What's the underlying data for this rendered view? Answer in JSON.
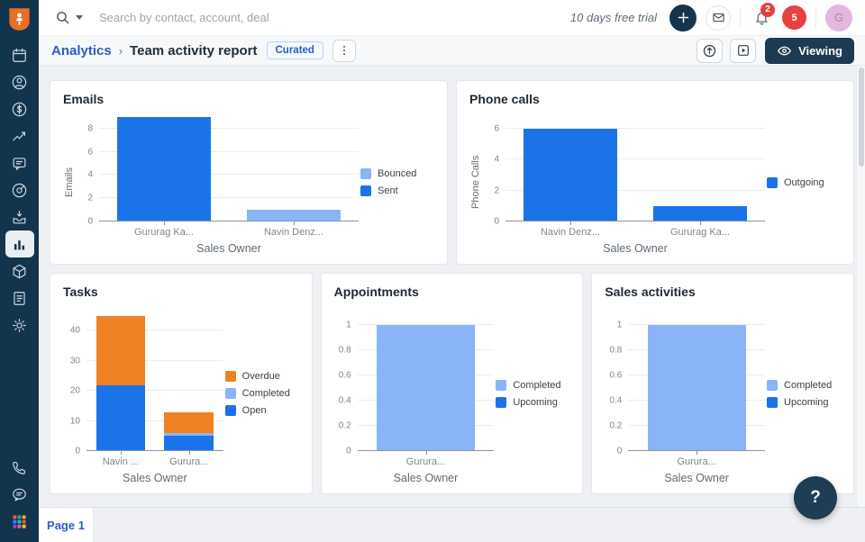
{
  "topbar": {
    "search_placeholder": "Search by contact, account, deal",
    "trial_text": "10 days free trial",
    "bell_badge": "2",
    "notif_count": "5",
    "avatar_initial": "G"
  },
  "breadcrumb": {
    "parent": "Analytics",
    "separator": "›",
    "title": "Team activity report",
    "badge": "Curated",
    "viewing_label": "Viewing"
  },
  "sidebar": {
    "icons": [
      "calendar-icon",
      "contacts-icon",
      "deals-icon",
      "trend-icon",
      "conversations-icon",
      "goals-icon",
      "inbox-icon",
      "analytics-icon",
      "products-icon",
      "invoices-icon",
      "settings-icon",
      "phone-icon",
      "chat-bubble-icon",
      "apps-grid-icon"
    ],
    "active_item": "analytics"
  },
  "footer": {
    "page_tab": "Page 1"
  },
  "help_label": "?",
  "colors": {
    "sidebar_navy": "#12344d",
    "primary_blue": "#1a73e8",
    "light_blue": "#8ab4f8",
    "orange": "#ee8123",
    "link_blue": "#2c5cc5",
    "badge_red": "#e43f3f",
    "avatar_pink": "#e5b7de"
  },
  "chart_data": [
    {
      "type": "bar",
      "title": "Emails",
      "ylabel": "Emails",
      "xlabel": "Sales Owner",
      "categories": [
        "Gururag Ka...",
        "Navin Denz..."
      ],
      "series": [
        {
          "name": "Sent",
          "color": "#1a73e8",
          "values": [
            9,
            0
          ]
        },
        {
          "name": "Bounced",
          "color": "#8ab4f8",
          "values": [
            0,
            1
          ]
        }
      ],
      "legend": [
        "Bounced",
        "Sent"
      ],
      "ymax": 9,
      "yticks": [
        0,
        2,
        4,
        6,
        8
      ]
    },
    {
      "type": "bar",
      "title": "Phone calls",
      "ylabel": "Phone Calls",
      "xlabel": "Sales Owner",
      "categories": [
        "Navin Denz...",
        "Gururag Ka..."
      ],
      "series": [
        {
          "name": "Outgoing",
          "color": "#1a73e8",
          "values": [
            6,
            1
          ]
        }
      ],
      "legend": [
        "Outgoing"
      ],
      "ymax": 6.75,
      "yticks": [
        0,
        2,
        4,
        6
      ]
    },
    {
      "type": "bar",
      "title": "Tasks",
      "ylabel": "",
      "xlabel": "Sales Owner",
      "categories": [
        "Navin ...",
        "Gurura..."
      ],
      "series": [
        {
          "name": "Open",
          "color": "#1a73e8",
          "values": [
            22,
            5
          ]
        },
        {
          "name": "Completed",
          "color": "#8ab4f8",
          "values": [
            0,
            1
          ]
        },
        {
          "name": "Overdue",
          "color": "#ee8123",
          "values": [
            23,
            7
          ]
        }
      ],
      "legend": [
        "Overdue",
        "Completed",
        "Open"
      ],
      "ymax": 47,
      "yticks": [
        0,
        10,
        20,
        30,
        40
      ]
    },
    {
      "type": "bar",
      "title": "Appointments",
      "ylabel": "",
      "xlabel": "Sales Owner",
      "categories": [
        "Gurura..."
      ],
      "series": [
        {
          "name": "Completed",
          "color": "#8ab4f8",
          "values": [
            1
          ]
        },
        {
          "name": "Upcoming",
          "color": "#1a73e8",
          "values": [
            0
          ]
        }
      ],
      "legend": [
        "Completed",
        "Upcoming"
      ],
      "ymax": 1.12,
      "yticks": [
        0,
        0.2,
        0.4,
        0.6,
        0.8,
        1
      ]
    },
    {
      "type": "bar",
      "title": "Sales activities",
      "ylabel": "",
      "xlabel": "Sales Owner",
      "categories": [
        "Gurura..."
      ],
      "series": [
        {
          "name": "Completed",
          "color": "#8ab4f8",
          "values": [
            1
          ]
        },
        {
          "name": "Upcoming",
          "color": "#1a73e8",
          "values": [
            0
          ]
        }
      ],
      "legend": [
        "Completed",
        "Upcoming"
      ],
      "ymax": 1.12,
      "yticks": [
        0,
        0.2,
        0.4,
        0.6,
        0.8,
        1
      ]
    }
  ]
}
